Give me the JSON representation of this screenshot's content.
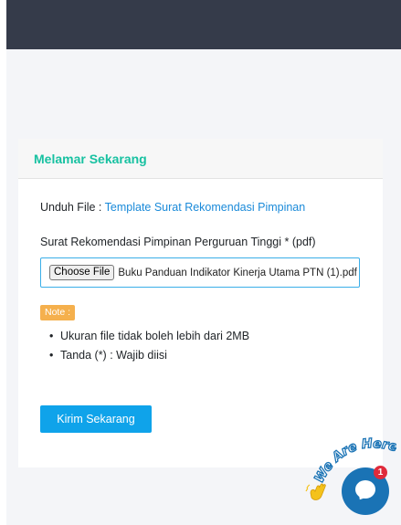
{
  "card": {
    "title": "Melamar Sekarang",
    "download_label": "Unduh File : ",
    "download_link": "Template Surat Rekomendasi Pimpinan",
    "field_label": "Surat Rekomendasi Pimpinan Perguruan Tinggi * (pdf)",
    "choose_file_label": "Choose File",
    "file_name": "Buku Panduan Indikator Kinerja Utama PTN (1).pdf",
    "note_label": "Note :",
    "notes": [
      "Ukuran file tidak boleh lebih dari 2MB",
      "Tanda (*) : Wajib diisi"
    ],
    "submit_label": "Kirim Sekarang"
  },
  "chat": {
    "greeting": "We Are Here!",
    "unread_count": "1",
    "icon": "chat-bubble-icon",
    "wave_icon": "waving-hand-icon"
  },
  "colors": {
    "header_bar": "#353b4a",
    "title_accent": "#17c1a1",
    "link": "#1a8ad9",
    "button": "#0fa3ea",
    "note_badge": "#f5b04d",
    "chat": "#1a73b5"
  }
}
